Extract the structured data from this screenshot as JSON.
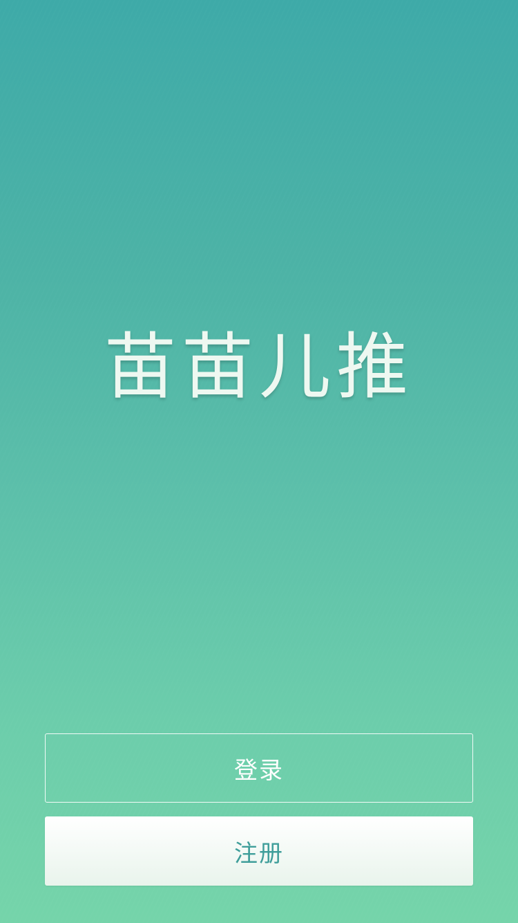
{
  "app": {
    "title": "苗苗儿推"
  },
  "actions": {
    "login_label": "登录",
    "register_label": "注册"
  },
  "colors": {
    "gradient_top": "#3eaaa8",
    "gradient_bottom": "#75d4aa",
    "title_color": "#eef8f1",
    "register_text": "#3f9e9a"
  }
}
